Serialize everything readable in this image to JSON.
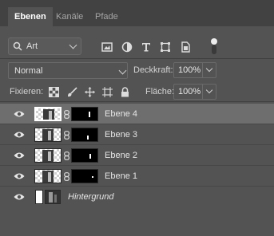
{
  "tabs": [
    {
      "label": "Ebenen",
      "active": true
    },
    {
      "label": "Kanäle",
      "active": false
    },
    {
      "label": "Pfade",
      "active": false
    }
  ],
  "filter": {
    "kind_label": "Art",
    "icons": [
      "image-filter-icon",
      "adjustment-filter-icon",
      "type-filter-icon",
      "shape-filter-icon",
      "smart-object-filter-icon"
    ],
    "toggle": "filter-toggle"
  },
  "blend": {
    "mode": "Normal",
    "opacity_label": "Deckkraft:",
    "opacity_value": "100%"
  },
  "lock": {
    "label": "Fixieren:",
    "icons": [
      "lock-transparent-icon",
      "lock-paint-icon",
      "lock-position-icon",
      "lock-artboard-icon",
      "lock-all-icon"
    ],
    "fill_label": "Fläche:",
    "fill_value": "100%"
  },
  "layers": [
    {
      "name": "Ebene 4",
      "selected": true
    },
    {
      "name": "Ebene 3",
      "selected": false
    },
    {
      "name": "Ebene 2",
      "selected": false
    },
    {
      "name": "Ebene 1",
      "selected": false
    },
    {
      "name": "Hintergrund",
      "selected": false,
      "background": true
    }
  ],
  "colors": {
    "panel": "#535353",
    "tabbar": "#424242",
    "selected_row": "#6e6e6e"
  }
}
